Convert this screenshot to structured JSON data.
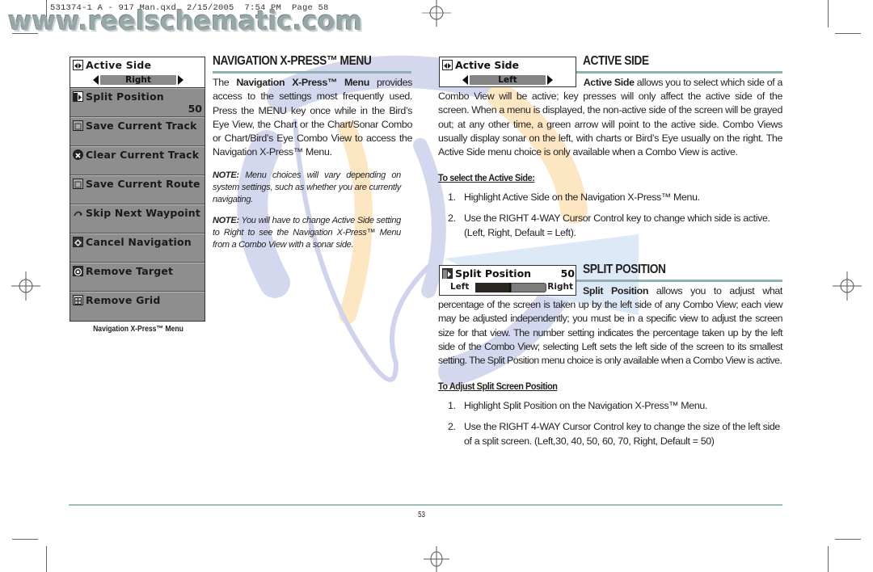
{
  "print_slug": "531374-1 A - 917 Man.qxd  2/15/2005  7:54 PM  Page 58",
  "watermark_text": "www.reelschematic.com",
  "colors": {
    "rule": "#8fb0b0",
    "menu_bg": "#8e8e8e",
    "logo_blue": "#cdd3ec",
    "logo_orange": "#fde4bd"
  },
  "menu": {
    "active_item": {
      "label": "Active Side",
      "icon": "left-right-arrows-icon",
      "value": "Right"
    },
    "items": [
      {
        "label": "Split Position",
        "icon": "split-screen-icon",
        "value": "50"
      },
      {
        "label": "Save Current Track",
        "icon": "save-icon",
        "value": ""
      },
      {
        "label": "Clear Current Track",
        "icon": "clear-x-icon",
        "value": ""
      },
      {
        "label": "Save Current Route",
        "icon": "save-icon",
        "value": ""
      },
      {
        "label": "Skip Next Waypoint",
        "icon": "skip-arrow-icon",
        "value": ""
      },
      {
        "label": "Cancel Navigation",
        "icon": "cancel-navigation-icon",
        "value": ""
      },
      {
        "label": "Remove Target",
        "icon": "target-icon",
        "value": ""
      },
      {
        "label": "Remove Grid",
        "icon": "grid-icon",
        "value": ""
      }
    ],
    "caption": "Navigation X-Press™ Menu"
  },
  "nav_section": {
    "heading": "NAVIGATION X-PRESS™ MENU",
    "intro_prefix": "The ",
    "intro_bold": "Navigation X-Press™ Menu",
    "intro_rest": " provides access to the settings most frequently used. Press the MENU key once while in the Bird’s Eye View, the Chart or the Chart/Sonar Combo or Chart/Bird’s Eye Combo View to access the Navigation X-Press™ Menu.",
    "note1_label": "NOTE:",
    "note1_text": " Menu choices will vary depending on system settings, such as whether you are currently navigating.",
    "note2_label": "NOTE:",
    "note2_text": " You will have to change Active Side setting to Right to see the Navigation X-Press™ Menu from a Combo View with a sonar side."
  },
  "active_side": {
    "heading": "ACTIVE SIDE",
    "widget": {
      "title": "Active Side",
      "value": "Left"
    },
    "lead_bold": "Active Side",
    "lead_rest": " allows you to select which side of a",
    "body": "Combo View will be active; key presses will only affect the active side of the screen. When a menu is displayed, the non-active side of the screen will be grayed out; at any other time, a green arrow will point to the active side. Combo Views usually display sonar on the left, with charts or Bird’s Eye usually on the right. The Active Side menu choice is only available when a Combo View is active.",
    "subhead": "To select the Active Side:",
    "steps": [
      {
        "num": "1.",
        "text": "Highlight Active Side on the Navigation X-Press™ Menu."
      },
      {
        "num": "2.",
        "text": "Use the RIGHT 4-WAY Cursor Control key to change which side is active. (Left, Right, Default = Left)."
      }
    ]
  },
  "split_position": {
    "heading": "SPLIT POSITION",
    "widget": {
      "title": "Split Position",
      "value": "50",
      "left_label": "Left",
      "right_label": "Right",
      "split_percent": 50
    },
    "lead_bold": "Split Position",
    "lead_rest": " allows you to adjust what",
    "body": "percentage of the screen is taken up by the left side of any Combo View; each view may be adjusted independently; you must be in a specific view to adjust the screen size for that view. The number setting indicates the percentage taken up by the left side of the Combo View; selecting Left sets the left side of the screen to its smallest setting. The Split Position menu choice is only available when a Combo View is active.",
    "subhead": "To Adjust Split Screen Position",
    "steps": [
      {
        "num": "1.",
        "text": "Highlight Split Position on the Navigation X-Press™ Menu."
      },
      {
        "num": "2.",
        "text": "Use the RIGHT 4-WAY Cursor Control key to change the size of the left side of a split screen. (Left,30, 40, 50, 60, 70, Right, Default = 50)"
      }
    ]
  },
  "footer": {
    "page_number": "53"
  }
}
